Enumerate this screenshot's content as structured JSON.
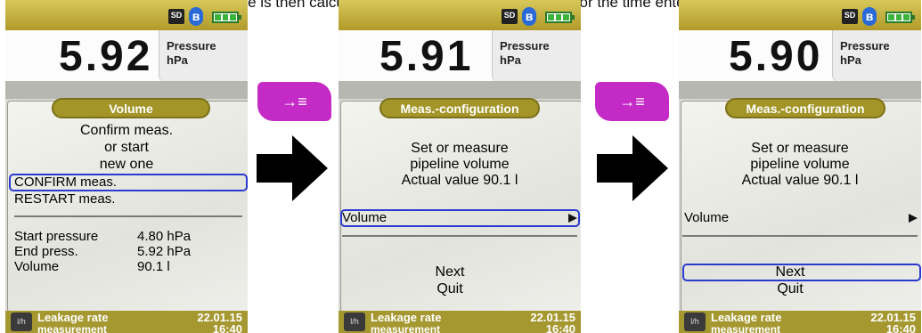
{
  "caption": "The leakage rate is then calculated and displayed on the screen for the time entered.",
  "colors": {
    "accent_gold": "#a59830",
    "softkey_magenta": "#c42ac6",
    "highlight_blue": "#2a3ad0"
  },
  "softkey_label": "→≡",
  "screens": [
    {
      "status": {
        "sd": "SD",
        "bluetooth_icon": "bluetooth-icon",
        "battery_icon": "battery-icon"
      },
      "value": "5.92",
      "unit_line1": "Pressure",
      "unit_line2": "hPa",
      "menu_title": "Volume",
      "lines": [
        "Confirm meas.",
        "or start",
        "new one"
      ],
      "options": [
        "CONFIRM meas.",
        "RESTART meas."
      ],
      "readings": [
        {
          "label": "Start pressure",
          "value": "4.80 hPa"
        },
        {
          "label": "End press.",
          "value": "5.92 hPa"
        },
        {
          "label": "Volume",
          "value": "90.1 l"
        }
      ],
      "footer": {
        "line1": "Leakage rate",
        "line2": "measurement",
        "date": "22.01.15",
        "time": "16:40"
      }
    },
    {
      "value": "5.91",
      "unit_line1": "Pressure",
      "unit_line2": "hPa",
      "menu_title": "Meas.-configuration",
      "lines": [
        "Set or measure",
        "pipeline volume",
        "Actual value  90.1 l"
      ],
      "volume_label": "Volume",
      "next_label": "Next",
      "quit_label": "Quit",
      "footer": {
        "line1": "Leakage rate",
        "line2": "measurement",
        "date": "22.01.15",
        "time": "16:40"
      }
    },
    {
      "value": "5.90",
      "unit_line1": "Pressure",
      "unit_line2": "hPa",
      "menu_title": "Meas.-configuration",
      "lines": [
        "Set or measure",
        "pipeline volume",
        "Actual value  90.1 l"
      ],
      "volume_label": "Volume",
      "next_label": "Next",
      "quit_label": "Quit",
      "footer": {
        "line1": "Leakage rate",
        "line2": "measurement",
        "date": "22.01.15",
        "time": "16:40"
      }
    }
  ]
}
